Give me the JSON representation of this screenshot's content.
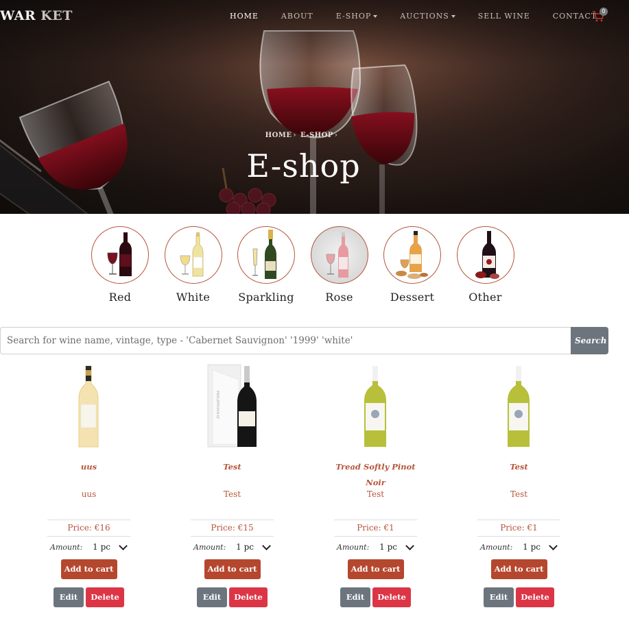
{
  "brand": {
    "part1": "WAR",
    "part2": "KET"
  },
  "nav": {
    "items": [
      {
        "label": "HOME",
        "active": true,
        "dropdown": false
      },
      {
        "label": "ABOUT",
        "active": false,
        "dropdown": false
      },
      {
        "label": "E-SHOP",
        "active": false,
        "dropdown": true
      },
      {
        "label": "AUCTIONS",
        "active": false,
        "dropdown": true
      },
      {
        "label": "SELL WINE",
        "active": false,
        "dropdown": false
      },
      {
        "label": "CONTACT",
        "active": false,
        "dropdown": false
      }
    ],
    "cart_count": "0",
    "cart_icon": "shopping-cart-icon"
  },
  "hero": {
    "breadcrumb": [
      "HOME",
      "E-SHOP"
    ],
    "title": "E-shop"
  },
  "categories": [
    {
      "label": "Red",
      "icon": "red-wine-bottle-icon"
    },
    {
      "label": "White",
      "icon": "white-wine-bottle-icon"
    },
    {
      "label": "Sparkling",
      "icon": "sparkling-wine-bottle-icon"
    },
    {
      "label": "Rose",
      "icon": "rose-wine-bottle-icon"
    },
    {
      "label": "Dessert",
      "icon": "dessert-wine-bottle-icon"
    },
    {
      "label": "Other",
      "icon": "other-wine-bottle-icon"
    }
  ],
  "search": {
    "placeholder": "Search for wine name, vintage, type - 'Cabernet Sauvignon' '1999' 'white'",
    "button": "Search"
  },
  "products": [
    {
      "name": "uus",
      "description": "uus",
      "price": "Price: €16",
      "amount_label": "Amount:",
      "amount": "1 pc",
      "add_to_cart": "Add to cart",
      "edit": "Edit",
      "delete": "Delete"
    },
    {
      "name": "Test",
      "description": "Test",
      "price": "Price: €15",
      "amount_label": "Amount:",
      "amount": "1 pc",
      "add_to_cart": "Add to cart",
      "edit": "Edit",
      "delete": "Delete"
    },
    {
      "name": "Tread Softly Pinot Noir",
      "description": "Test",
      "price": "Price: €1",
      "amount_label": "Amount:",
      "amount": "1 pc",
      "add_to_cart": "Add to cart",
      "edit": "Edit",
      "delete": "Delete"
    },
    {
      "name": "Test",
      "description": "Test",
      "price": "Price: €1",
      "amount_label": "Amount:",
      "amount": "1 pc",
      "add_to_cart": "Add to cart",
      "edit": "Edit",
      "delete": "Delete"
    }
  ],
  "colors": {
    "accent": "#b5472e",
    "edit": "#6c757d",
    "delete": "#dc3545"
  }
}
